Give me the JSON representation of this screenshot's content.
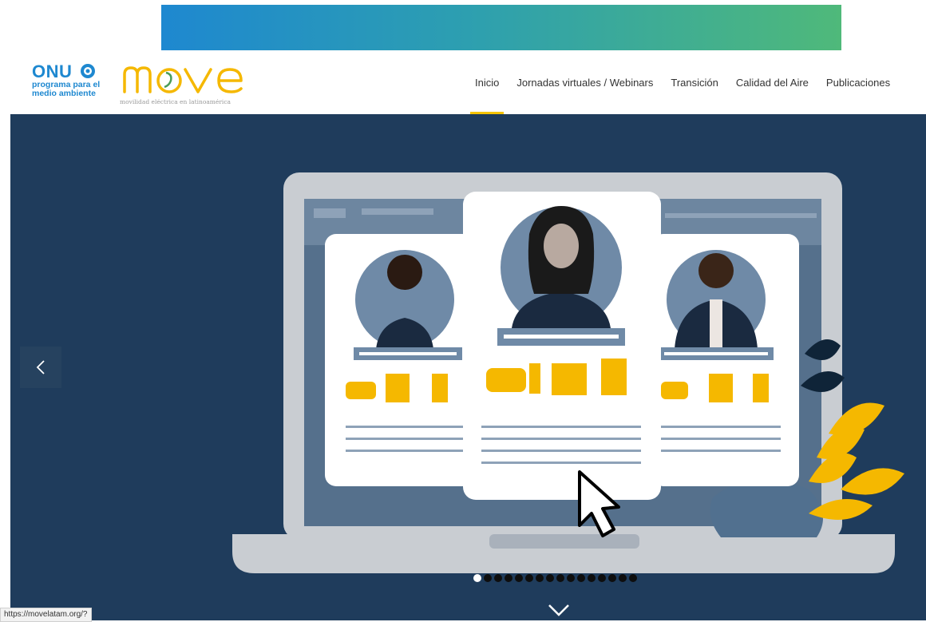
{
  "branding": {
    "onu_title": "ONU",
    "onu_line1": "programa para el",
    "onu_line2": "medio ambiente",
    "move_tagline": "movilidad eléctrica en latinoamérica"
  },
  "nav": {
    "items": [
      {
        "label": "Inicio",
        "active": true
      },
      {
        "label": "Jornadas virtuales / Webinars"
      },
      {
        "label": "Transición"
      },
      {
        "label": "Calidad del Aire"
      },
      {
        "label": "Publicaciones"
      }
    ]
  },
  "carousel": {
    "total_slides": 16,
    "active_index": 0
  },
  "status_bar": {
    "url": "https://movelatam.org/?"
  },
  "colors": {
    "accent": "#f5c400",
    "hero_bg": "#1f3c5c",
    "brand_blue": "#1e88d0"
  }
}
